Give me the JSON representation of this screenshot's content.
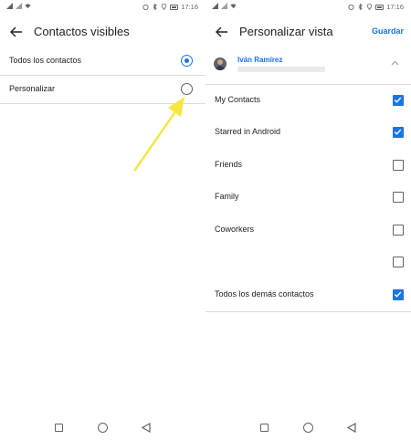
{
  "left": {
    "status": {
      "time": "17:16"
    },
    "title": "Contactos visibles",
    "options": [
      {
        "label": "Todos los contactos",
        "selected": true
      },
      {
        "label": "Personalizar",
        "selected": false
      }
    ]
  },
  "right": {
    "status": {
      "time": "17:16"
    },
    "title": "Personalizar vista",
    "save_label": "Guardar",
    "account": {
      "name": "Iván Ramírez"
    },
    "groups": [
      {
        "label": "My Contacts",
        "checked": true
      },
      {
        "label": "Starred in Android",
        "checked": true
      },
      {
        "label": "Friends",
        "checked": false
      },
      {
        "label": "Family",
        "checked": false
      },
      {
        "label": "Coworkers",
        "checked": false
      },
      {
        "label": "",
        "checked": false
      },
      {
        "label": "Todos los demás contactos",
        "checked": true
      }
    ]
  },
  "colors": {
    "accent": "#1a73e8",
    "annotation": "#f5e642"
  },
  "icons": [
    "back-arrow-icon",
    "radio-icon",
    "checkbox-icon",
    "chevron-up-icon",
    "nav-recents-icon",
    "nav-home-icon",
    "nav-back-icon"
  ]
}
